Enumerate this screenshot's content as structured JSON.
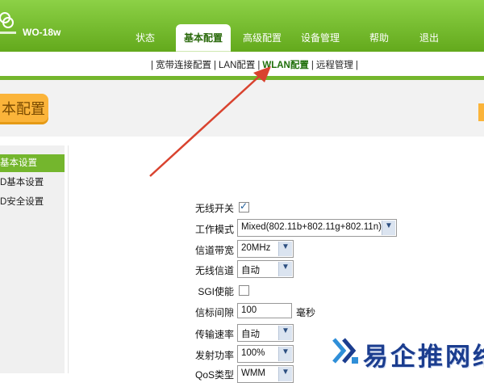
{
  "header": {
    "model": "WO-18w",
    "nav": [
      {
        "label": "状态"
      },
      {
        "label": "基本配置",
        "active": true
      },
      {
        "label": "高级配置"
      },
      {
        "label": "设备管理"
      },
      {
        "label": "帮助"
      },
      {
        "label": "退出"
      }
    ]
  },
  "subnav": {
    "items": [
      "宽带连接配置",
      "LAN配置",
      "WLAN配置",
      "远程管理"
    ],
    "active_index": 2
  },
  "page": {
    "title": "本配置"
  },
  "sidebar": {
    "items": [
      {
        "label": "基本设置",
        "active": true
      },
      {
        "label": "D基本设置"
      },
      {
        "label": "D安全设置"
      }
    ]
  },
  "form": {
    "wireless_switch": {
      "label": "无线开关",
      "checked": true
    },
    "work_mode": {
      "label": "工作模式",
      "value": "Mixed(802.11b+802.11g+802.11n)"
    },
    "bandwidth": {
      "label": "信道带宽",
      "value": "20MHz"
    },
    "channel": {
      "label": "无线信道",
      "value": "自动"
    },
    "sgi": {
      "label": "SGI使能",
      "checked": false
    },
    "beacon": {
      "label": "信标间隙",
      "value": "100",
      "unit": "毫秒"
    },
    "tx_rate": {
      "label": "传输速率",
      "value": "自动"
    },
    "tx_power": {
      "label": "发射功率",
      "value": "100%"
    },
    "qos": {
      "label": "QoS类型",
      "value": "WMM"
    }
  },
  "watermark": {
    "text": "易企推网络"
  },
  "colors": {
    "header_green": "#74b62d",
    "title_orange": "#fbb43a",
    "arrow_red": "#d9432f",
    "watermark_blue": "#1b3d8f"
  }
}
